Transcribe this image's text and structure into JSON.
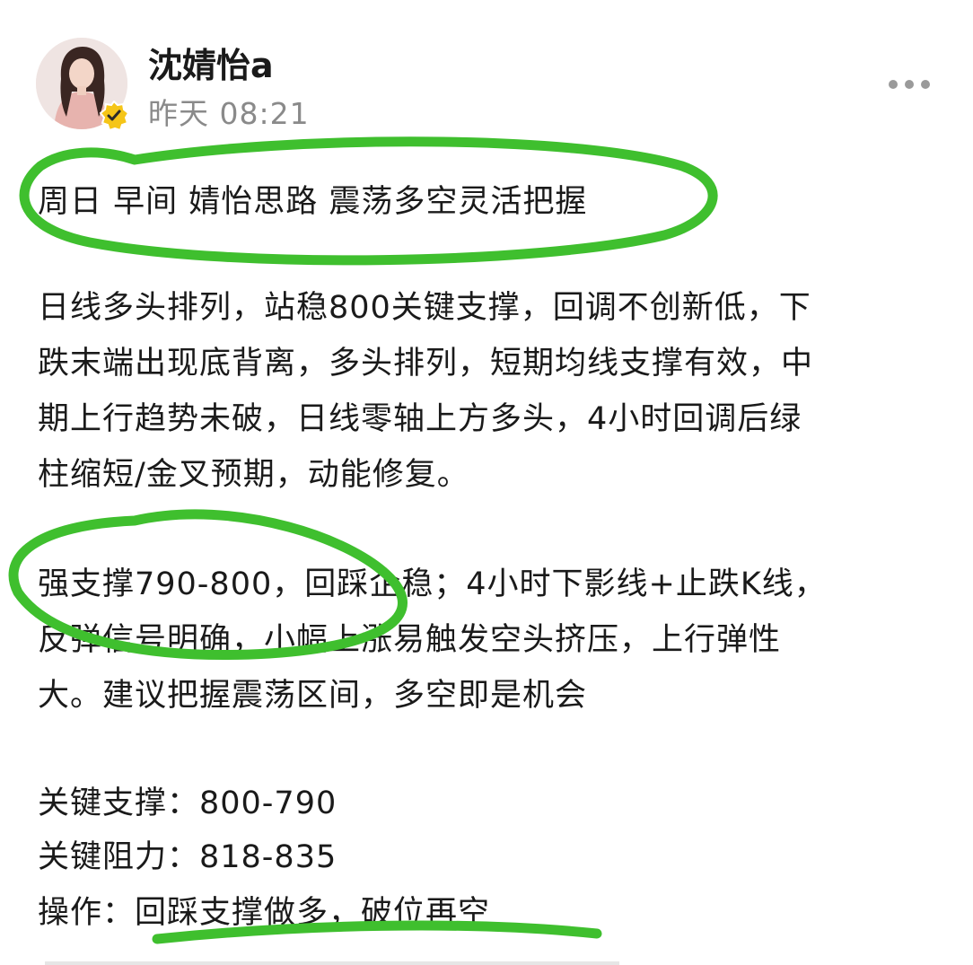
{
  "post": {
    "author": "沈婧怡a",
    "time": "昨天 08:21",
    "headline": "周日 早间 婧怡思路  震荡多空灵活把握",
    "paragraph1": [
      "日线多头排列，站稳800关键支撑，回调不创新低，下",
      "跌末端出现底背离，多头排列，短期均线支撑有效，中",
      "期上行趋势未破，日线零轴上方多头，4小时回调后绿",
      "柱缩短/金叉预期，动能修复。"
    ],
    "paragraph2": [
      "强支撑790-800，回踩企稳；4小时下影线+止跌K线，",
      "反弹信号明确，小幅上涨易触发空头挤压，上行弹性",
      "大。建议把握震荡区间，多空即是机会"
    ],
    "key_support": "关键支撑：800-790",
    "key_resistance": "关键阻力：818-835",
    "operation": "操作：回踩支撑做多，破位再空"
  },
  "icons": {
    "verified": "verified-badge-icon",
    "more": "more-dots-icon"
  },
  "colors": {
    "highlight_green": "#3fbf2e",
    "verified_yellow": "#f5c518",
    "time_gray": "#8a8a8a"
  }
}
